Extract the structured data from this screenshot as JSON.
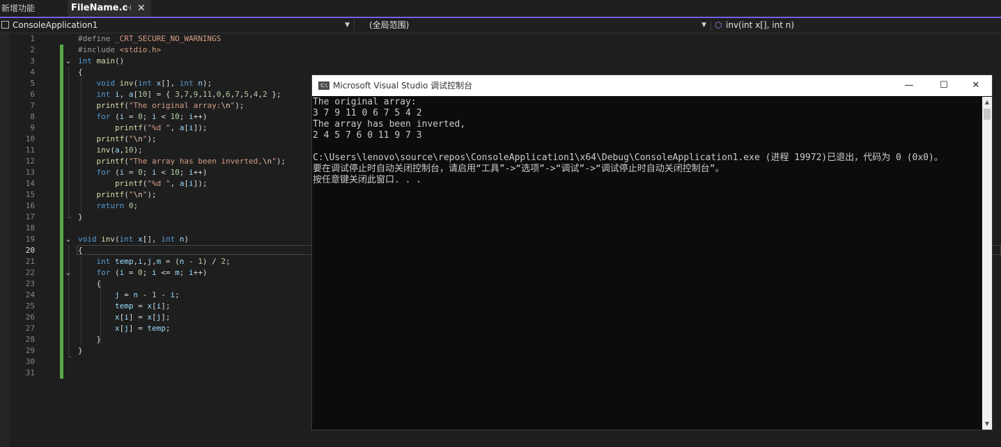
{
  "tabs": {
    "inactive_label": "新增功能",
    "active_label": "FileName.c",
    "pin_glyph": "⊣",
    "close_glyph": "✕"
  },
  "navbar": {
    "project": "ConsoleApplication1",
    "scope": "(全局范围)",
    "member": "inv(int x[], int n)"
  },
  "editor": {
    "current_line": 20,
    "line_numbers": [
      "1",
      "2",
      "3",
      "4",
      "5",
      "6",
      "7",
      "8",
      "9",
      "10",
      "11",
      "12",
      "13",
      "14",
      "15",
      "16",
      "17",
      "18",
      "19",
      "20",
      "21",
      "22",
      "23",
      "24",
      "25",
      "26",
      "27",
      "28",
      "29",
      "30",
      "31"
    ],
    "lines": [
      "#define _CRT_SECURE_NO_WARNINGS",
      "#include <stdio.h>",
      "int main()",
      "{",
      "    void inv(int x[], int n);",
      "    int i, a[10] = { 3,7,9,11,0,6,7,5,4,2 };",
      "    printf(\"The original array:\\n\");",
      "    for (i = 0; i < 10; i++)",
      "        printf(\"%d \", a[i]);",
      "    printf(\"\\n\");",
      "    inv(a,10);",
      "    printf(\"The array has been inverted,\\n\");",
      "    for (i = 0; i < 10; i++)",
      "        printf(\"%d \", a[i]);",
      "    printf(\"\\n\");",
      "    return 0;",
      "}",
      "",
      "void inv(int x[], int n)",
      "{",
      "    int temp,i,j,m = (n - 1) / 2;",
      "    for (i = 0; i <= m; i++)",
      "    {",
      "        j = n - 1 - i;",
      "        temp = x[i];",
      "        x[i] = x[j];",
      "        x[j] = temp;",
      "    }",
      "}",
      "",
      ""
    ]
  },
  "console": {
    "title": "Microsoft Visual Studio 调试控制台",
    "icon_text": "C:\\",
    "buttons": {
      "minimize": "—",
      "maximize": "☐",
      "close": "✕"
    },
    "output": [
      "The original array:",
      "3 7 9 11 0 6 7 5 4 2",
      "The array has been inverted,",
      "2 4 5 7 6 0 11 9 7 3",
      "",
      "C:\\Users\\lenovo\\source\\repos\\ConsoleApplication1\\x64\\Debug\\ConsoleApplication1.exe (进程 19972)已退出，代码为 0 (0x0)。",
      "要在调试停止时自动关闭控制台，请启用“工具”->“选项”->“调试”->“调试停止时自动关闭控制台”。",
      "按任意键关闭此窗口. . ."
    ]
  }
}
